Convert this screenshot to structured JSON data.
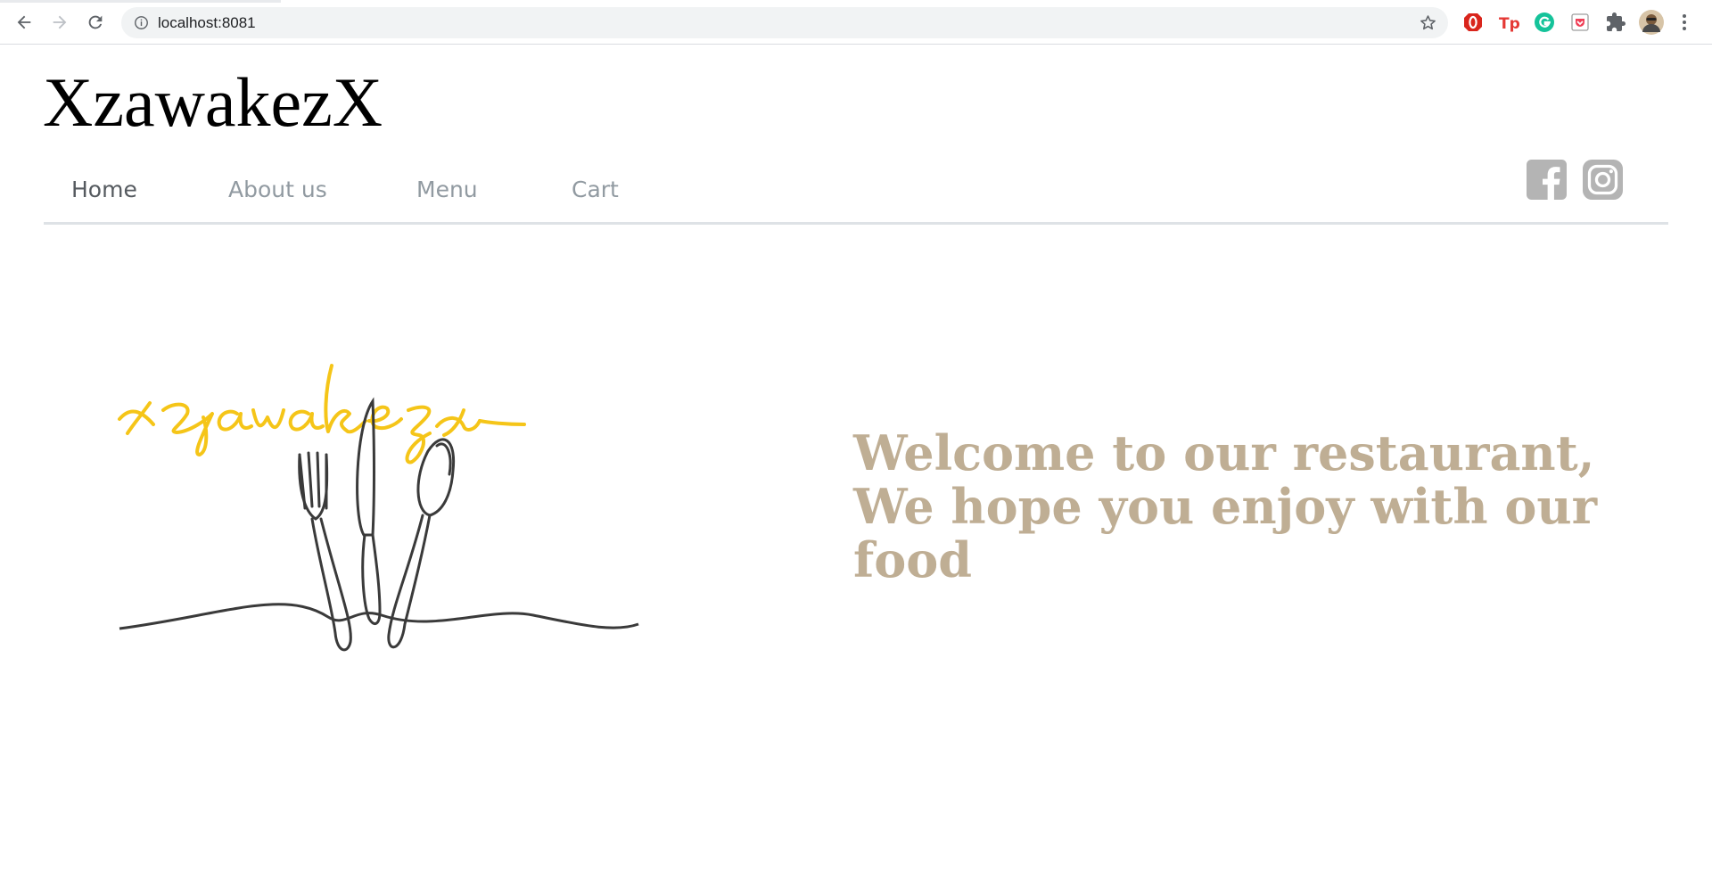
{
  "browser": {
    "url": "localhost:8081",
    "icons": {
      "back": "arrow-back-icon",
      "forward": "arrow-forward-icon",
      "reload": "reload-icon",
      "site_info": "info-icon",
      "bookmark": "star-icon",
      "extensions": [
        "opera-adblock-icon",
        "tp-icon",
        "grammarly-icon",
        "pocket-icon",
        "puzzle-icon",
        "profile-avatar"
      ],
      "menu": "kebab-menu-icon"
    }
  },
  "site": {
    "title": "XzawakezX",
    "nav": [
      {
        "label": "Home",
        "active": true
      },
      {
        "label": "About us",
        "active": false
      },
      {
        "label": "Menu",
        "active": false
      },
      {
        "label": "Cart",
        "active": false
      }
    ],
    "social_icons": [
      "facebook-icon",
      "instagram-icon"
    ],
    "logo_script": "xzawakezx",
    "welcome_lines": [
      "Welcome to our restaurant,",
      "We hope you enjoy with our",
      "food"
    ]
  },
  "colors": {
    "nav_active": "#555a5f",
    "nav_inactive": "#919aa1",
    "welcome": "#bfae94",
    "logo_script": "#f5c518",
    "social": "#b4b4b4"
  }
}
